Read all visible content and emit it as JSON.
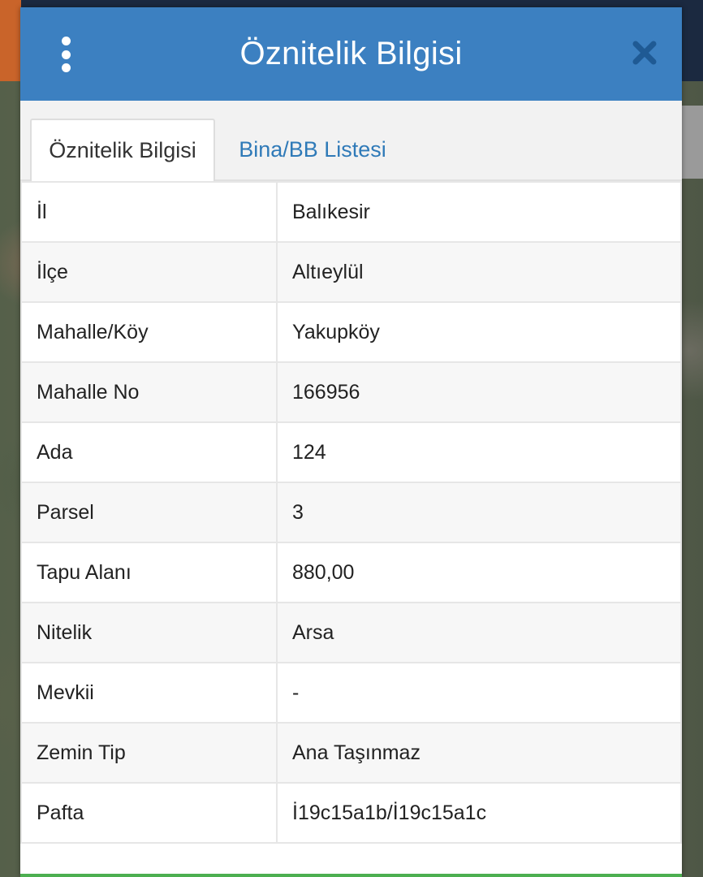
{
  "dialog": {
    "title": "Öznitelik Bilgisi",
    "menu_icon": "more-vertical-icon",
    "close_icon": "close-icon"
  },
  "tabs": [
    {
      "label": "Öznitelik Bilgisi",
      "active": true
    },
    {
      "label": "Bina/BB Listesi",
      "active": false
    }
  ],
  "rows": [
    {
      "key": "İl",
      "value": "Balıkesir"
    },
    {
      "key": "İlçe",
      "value": "Altıeylül"
    },
    {
      "key": "Mahalle/Köy",
      "value": "Yakupköy"
    },
    {
      "key": "Mahalle No",
      "value": "166956"
    },
    {
      "key": "Ada",
      "value": "124"
    },
    {
      "key": "Parsel",
      "value": "3"
    },
    {
      "key": "Tapu Alanı",
      "value": "880,00"
    },
    {
      "key": "Nitelik",
      "value": "Arsa"
    },
    {
      "key": "Mevkii",
      "value": "-"
    },
    {
      "key": "Zemin Tip",
      "value": "Ana Taşınmaz"
    },
    {
      "key": "Pafta",
      "value": "İ19c15a1b/İ19c15a1c"
    }
  ],
  "colors": {
    "header": "#3c80c1",
    "tab_link": "#2f7ab8",
    "close_icon": "#1f5a94"
  }
}
